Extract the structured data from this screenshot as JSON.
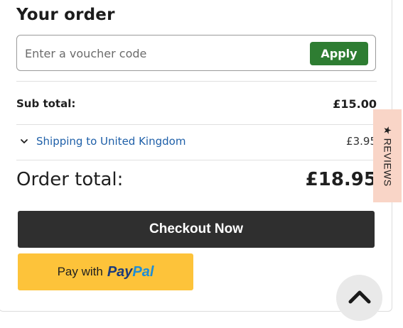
{
  "order": {
    "title": "Your order",
    "voucher": {
      "placeholder": "Enter a voucher code",
      "value": "",
      "apply_label": "Apply"
    },
    "subtotal": {
      "label": "Sub total:",
      "value": "£15.00"
    },
    "shipping": {
      "label": "Shipping to United Kingdom",
      "value": "£3.95",
      "icon": "chevron-down-icon"
    },
    "total": {
      "label": "Order total:",
      "value": "£18.95"
    },
    "checkout_label": "Checkout Now",
    "paypal": {
      "prefix": "Pay with",
      "brand_part1": "Pay",
      "brand_part2": "Pal"
    }
  },
  "reviews_tab": {
    "label": "★ REVIEWS"
  },
  "scroll_top": {
    "icon": "chevron-up-icon"
  },
  "colors": {
    "apply_button": "#2e7d32",
    "checkout_button": "#2f2f2f",
    "paypal_button": "#fdc33a",
    "paypal_dark": "#1b3a7a",
    "paypal_light": "#1f8dd6",
    "link": "#1e5fa8",
    "reviews_tab": "#f9d5c7"
  }
}
